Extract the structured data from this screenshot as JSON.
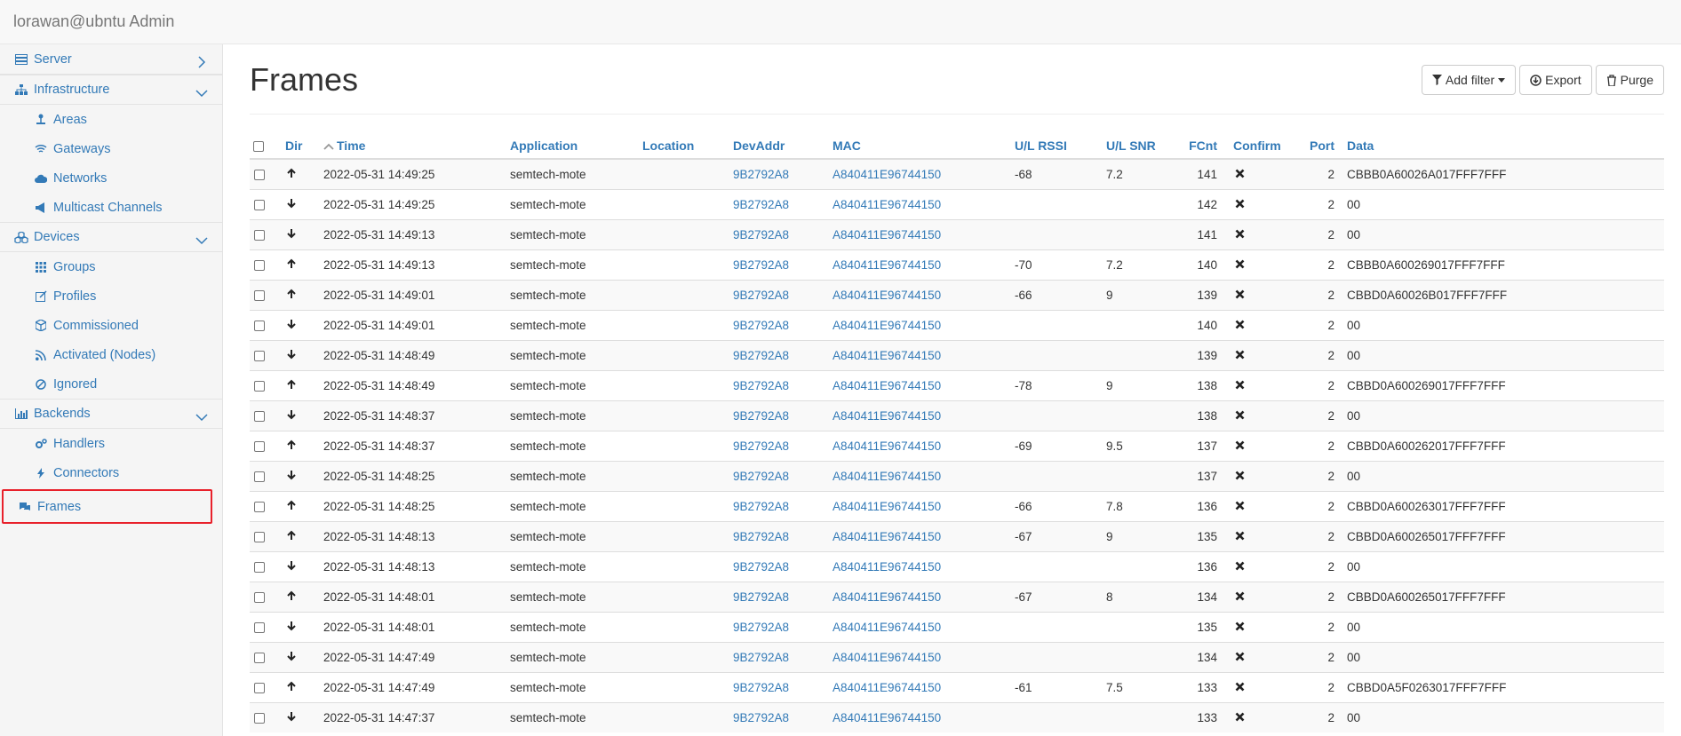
{
  "brand": "lorawan@ubntu Admin",
  "sidebar": {
    "items": [
      {
        "label": "Server",
        "icon": "server-icon",
        "level": 0,
        "chevron": "right"
      },
      {
        "label": "Infrastructure",
        "icon": "sitemap-icon",
        "level": 0,
        "chevron": "down"
      },
      {
        "label": "Areas",
        "icon": "pin-icon",
        "level": 1
      },
      {
        "label": "Gateways",
        "icon": "wifi-icon",
        "level": 1
      },
      {
        "label": "Networks",
        "icon": "cloud-icon",
        "level": 1
      },
      {
        "label": "Multicast Channels",
        "icon": "bullhorn-icon",
        "level": 1
      },
      {
        "label": "Devices",
        "icon": "cubes-icon",
        "level": 0,
        "chevron": "down"
      },
      {
        "label": "Groups",
        "icon": "grid-icon",
        "level": 1
      },
      {
        "label": "Profiles",
        "icon": "edit-icon",
        "level": 1
      },
      {
        "label": "Commissioned",
        "icon": "cube-icon",
        "level": 1
      },
      {
        "label": "Activated (Nodes)",
        "icon": "rss-icon",
        "level": 1
      },
      {
        "label": "Ignored",
        "icon": "ban-icon",
        "level": 1
      },
      {
        "label": "Backends",
        "icon": "bar-chart-icon",
        "level": 0,
        "chevron": "down"
      },
      {
        "label": "Handlers",
        "icon": "cogs-icon",
        "level": 1
      },
      {
        "label": "Connectors",
        "icon": "bolt-icon",
        "level": 1
      },
      {
        "label": "Frames",
        "icon": "comments-icon",
        "level": 0,
        "active": true
      }
    ]
  },
  "main": {
    "title": "Frames",
    "buttons": {
      "add_filter": "Add filter",
      "export": "Export",
      "purge": "Purge"
    },
    "columns": [
      "Dir",
      "Time",
      "Application",
      "Location",
      "DevAddr",
      "MAC",
      "U/L RSSI",
      "U/L SNR",
      "FCnt",
      "Confirm",
      "Port",
      "Data"
    ],
    "rows": [
      {
        "dir": "up",
        "time": "2022-05-31 14:49:25",
        "app": "semtech-mote",
        "location": "",
        "devaddr": "9B2792A8",
        "mac": "A840411E96744150",
        "rssi": "-68",
        "snr": "7.2",
        "fcnt": "141",
        "port": "2",
        "data": "CBBB0A60026A017FFF7FFF"
      },
      {
        "dir": "down",
        "time": "2022-05-31 14:49:25",
        "app": "semtech-mote",
        "location": "",
        "devaddr": "9B2792A8",
        "mac": "A840411E96744150",
        "rssi": "",
        "snr": "",
        "fcnt": "142",
        "port": "2",
        "data": "00"
      },
      {
        "dir": "down",
        "time": "2022-05-31 14:49:13",
        "app": "semtech-mote",
        "location": "",
        "devaddr": "9B2792A8",
        "mac": "A840411E96744150",
        "rssi": "",
        "snr": "",
        "fcnt": "141",
        "port": "2",
        "data": "00"
      },
      {
        "dir": "up",
        "time": "2022-05-31 14:49:13",
        "app": "semtech-mote",
        "location": "",
        "devaddr": "9B2792A8",
        "mac": "A840411E96744150",
        "rssi": "-70",
        "snr": "7.2",
        "fcnt": "140",
        "port": "2",
        "data": "CBBB0A600269017FFF7FFF"
      },
      {
        "dir": "up",
        "time": "2022-05-31 14:49:01",
        "app": "semtech-mote",
        "location": "",
        "devaddr": "9B2792A8",
        "mac": "A840411E96744150",
        "rssi": "-66",
        "snr": "9",
        "fcnt": "139",
        "port": "2",
        "data": "CBBD0A60026B017FFF7FFF"
      },
      {
        "dir": "down",
        "time": "2022-05-31 14:49:01",
        "app": "semtech-mote",
        "location": "",
        "devaddr": "9B2792A8",
        "mac": "A840411E96744150",
        "rssi": "",
        "snr": "",
        "fcnt": "140",
        "port": "2",
        "data": "00"
      },
      {
        "dir": "down",
        "time": "2022-05-31 14:48:49",
        "app": "semtech-mote",
        "location": "",
        "devaddr": "9B2792A8",
        "mac": "A840411E96744150",
        "rssi": "",
        "snr": "",
        "fcnt": "139",
        "port": "2",
        "data": "00"
      },
      {
        "dir": "up",
        "time": "2022-05-31 14:48:49",
        "app": "semtech-mote",
        "location": "",
        "devaddr": "9B2792A8",
        "mac": "A840411E96744150",
        "rssi": "-78",
        "snr": "9",
        "fcnt": "138",
        "port": "2",
        "data": "CBBD0A600269017FFF7FFF"
      },
      {
        "dir": "down",
        "time": "2022-05-31 14:48:37",
        "app": "semtech-mote",
        "location": "",
        "devaddr": "9B2792A8",
        "mac": "A840411E96744150",
        "rssi": "",
        "snr": "",
        "fcnt": "138",
        "port": "2",
        "data": "00"
      },
      {
        "dir": "up",
        "time": "2022-05-31 14:48:37",
        "app": "semtech-mote",
        "location": "",
        "devaddr": "9B2792A8",
        "mac": "A840411E96744150",
        "rssi": "-69",
        "snr": "9.5",
        "fcnt": "137",
        "port": "2",
        "data": "CBBD0A600262017FFF7FFF"
      },
      {
        "dir": "down",
        "time": "2022-05-31 14:48:25",
        "app": "semtech-mote",
        "location": "",
        "devaddr": "9B2792A8",
        "mac": "A840411E96744150",
        "rssi": "",
        "snr": "",
        "fcnt": "137",
        "port": "2",
        "data": "00"
      },
      {
        "dir": "up",
        "time": "2022-05-31 14:48:25",
        "app": "semtech-mote",
        "location": "",
        "devaddr": "9B2792A8",
        "mac": "A840411E96744150",
        "rssi": "-66",
        "snr": "7.8",
        "fcnt": "136",
        "port": "2",
        "data": "CBBD0A600263017FFF7FFF"
      },
      {
        "dir": "up",
        "time": "2022-05-31 14:48:13",
        "app": "semtech-mote",
        "location": "",
        "devaddr": "9B2792A8",
        "mac": "A840411E96744150",
        "rssi": "-67",
        "snr": "9",
        "fcnt": "135",
        "port": "2",
        "data": "CBBD0A600265017FFF7FFF"
      },
      {
        "dir": "down",
        "time": "2022-05-31 14:48:13",
        "app": "semtech-mote",
        "location": "",
        "devaddr": "9B2792A8",
        "mac": "A840411E96744150",
        "rssi": "",
        "snr": "",
        "fcnt": "136",
        "port": "2",
        "data": "00"
      },
      {
        "dir": "up",
        "time": "2022-05-31 14:48:01",
        "app": "semtech-mote",
        "location": "",
        "devaddr": "9B2792A8",
        "mac": "A840411E96744150",
        "rssi": "-67",
        "snr": "8",
        "fcnt": "134",
        "port": "2",
        "data": "CBBD0A600265017FFF7FFF"
      },
      {
        "dir": "down",
        "time": "2022-05-31 14:48:01",
        "app": "semtech-mote",
        "location": "",
        "devaddr": "9B2792A8",
        "mac": "A840411E96744150",
        "rssi": "",
        "snr": "",
        "fcnt": "135",
        "port": "2",
        "data": "00"
      },
      {
        "dir": "down",
        "time": "2022-05-31 14:47:49",
        "app": "semtech-mote",
        "location": "",
        "devaddr": "9B2792A8",
        "mac": "A840411E96744150",
        "rssi": "",
        "snr": "",
        "fcnt": "134",
        "port": "2",
        "data": "00"
      },
      {
        "dir": "up",
        "time": "2022-05-31 14:47:49",
        "app": "semtech-mote",
        "location": "",
        "devaddr": "9B2792A8",
        "mac": "A840411E96744150",
        "rssi": "-61",
        "snr": "7.5",
        "fcnt": "133",
        "port": "2",
        "data": "CBBD0A5F0263017FFF7FFF"
      },
      {
        "dir": "down",
        "time": "2022-05-31 14:47:37",
        "app": "semtech-mote",
        "location": "",
        "devaddr": "9B2792A8",
        "mac": "A840411E96744150",
        "rssi": "",
        "snr": "",
        "fcnt": "133",
        "port": "2",
        "data": "00"
      }
    ]
  },
  "colors": {
    "link": "#337ab7",
    "active_outline": "#e8212b"
  }
}
